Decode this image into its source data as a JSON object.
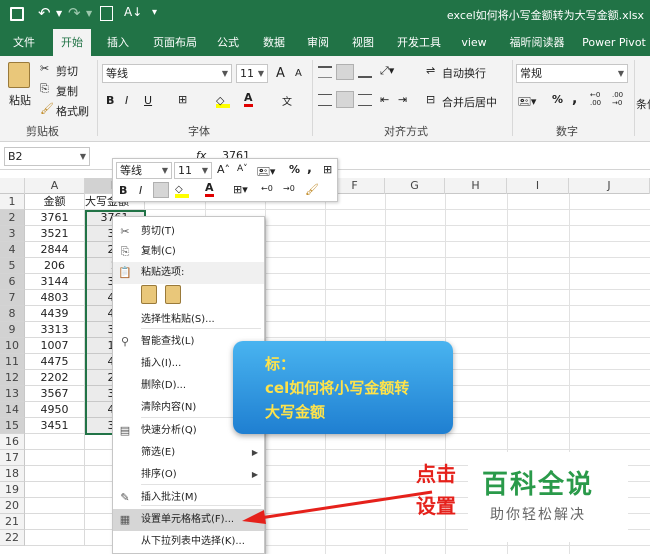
{
  "titlebar": {
    "filename": "excel如何将小写金额转为大写金额.xlsx",
    "save_icon": "save-icon",
    "undo_icon": "undo-icon",
    "redo_icon": "redo-icon"
  },
  "tabs": [
    "文件",
    "开始",
    "插入",
    "页面布局",
    "公式",
    "数据",
    "审阅",
    "视图",
    "开发工具",
    "view",
    "福昕阅读器",
    "Power Pivot"
  ],
  "active_tab": "开始",
  "ribbon": {
    "clipboard": {
      "paste": "粘贴",
      "cut": "剪切",
      "copy": "复制",
      "format_painter": "格式刷",
      "group": "剪贴板"
    },
    "font": {
      "name": "等线",
      "size": "11",
      "group": "字体",
      "bold": "B",
      "italic": "I",
      "underline": "U",
      "grow": "A",
      "shrink": "A"
    },
    "alignment": {
      "wrap": "自动换行",
      "merge": "合并后居中",
      "group": "对齐方式"
    },
    "number": {
      "format": "常规",
      "percent": "%",
      "comma": ",",
      "group": "数字",
      "inc_dec": "←0 .00",
      "dec_dec": ".00 →0"
    },
    "cond": "条件"
  },
  "formula_bar": {
    "name_box": "B2",
    "value": "3761",
    "fx": "fx"
  },
  "columns": [
    "A",
    "B",
    "C",
    "D",
    "E",
    "F",
    "G",
    "H",
    "I",
    "J"
  ],
  "rows": [
    "1",
    "2",
    "3",
    "4",
    "5",
    "6",
    "7",
    "8",
    "9",
    "10",
    "11",
    "12",
    "13",
    "14",
    "15",
    "16",
    "17",
    "18",
    "19",
    "20",
    "21",
    "22"
  ],
  "col_a": [
    "金额",
    "3761",
    "3521",
    "2844",
    "206",
    "3144",
    "4803",
    "4439",
    "3313",
    "1007",
    "4475",
    "2202",
    "3567",
    "4950",
    "3451"
  ],
  "col_b": [
    "大写金额",
    "3761",
    "35",
    "28",
    "2",
    "31",
    "48",
    "44",
    "33",
    "10",
    "44",
    "22",
    "35",
    "49",
    "34"
  ],
  "mini_toolbar": {
    "font": "等线",
    "size": "11",
    "percent": "%",
    "comma": ",",
    "bold": "B",
    "italic": "I"
  },
  "context_menu": {
    "items": [
      {
        "label": "剪切(T)",
        "icon": "scissors-icon"
      },
      {
        "label": "复制(C)",
        "icon": "copy-icon"
      },
      {
        "label": "粘贴选项:",
        "icon": "paste-icon"
      },
      {
        "label": "选择性粘贴(S)...",
        "icon": ""
      },
      {
        "label": "智能查找(L)",
        "icon": "search-icon"
      },
      {
        "label": "插入(I)...",
        "icon": ""
      },
      {
        "label": "删除(D)...",
        "icon": ""
      },
      {
        "label": "清除内容(N)",
        "icon": ""
      },
      {
        "label": "快速分析(Q)",
        "icon": "quick-analysis-icon"
      },
      {
        "label": "筛选(E)",
        "icon": ""
      },
      {
        "label": "排序(O)",
        "icon": ""
      },
      {
        "label": "插入批注(M)",
        "icon": "comment-icon"
      },
      {
        "label": "设置单元格格式(F)...",
        "icon": "format-cells-icon"
      },
      {
        "label": "从下拉列表中选择(K)...",
        "icon": ""
      }
    ]
  },
  "overlay": {
    "banner_line1": "标：",
    "banner_line2": "cel如何将小写金额转",
    "banner_line3": "大写金额",
    "annotation_1": "点击",
    "annotation_2": "设置",
    "watermark_title": "百科全说",
    "watermark_sub": "助你轻松解决"
  }
}
